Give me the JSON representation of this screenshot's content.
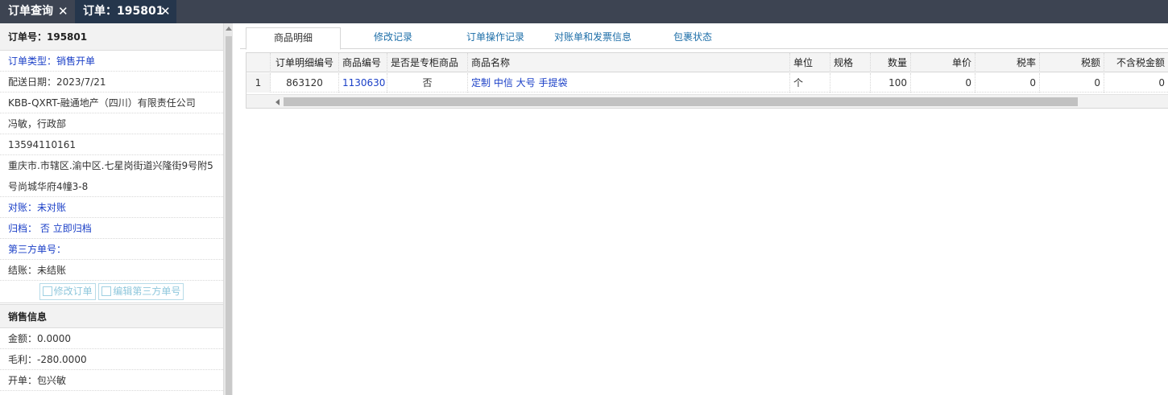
{
  "top_tabs": [
    {
      "label": "订单查询",
      "close": "✕"
    },
    {
      "label": "订单：195801",
      "close": "✕"
    }
  ],
  "order": {
    "header": "订单号：195801",
    "type": "订单类型：销售开单",
    "delivery_date": "配送日期：2023/7/21",
    "company": "KBB-QXRT-融通地产（四川）有限责任公司",
    "contact": "冯敏，行政部",
    "phone": "13594110161",
    "address": "重庆市.市辖区.渝中区.七星岗街道兴隆街9号附5号尚城华府4幢3-8",
    "reconcile": "对账：未对账",
    "archive_label": "归档：",
    "archive_value": "否",
    "archive_link": "立即归档",
    "third_party": "第三方单号：",
    "settle": "结账：未结账",
    "btn_edit": "修改订单",
    "btn_third": "编辑第三方单号"
  },
  "sales": {
    "header": "销售信息",
    "amount": "金额：0.0000",
    "profit": "毛利：-280.0000",
    "creator": "开单：包兴敏"
  },
  "detail_tabs": [
    "商品明细",
    "修改记录",
    "订单操作记录",
    "对账单和发票信息",
    "包裹状态"
  ],
  "grid": {
    "columns": [
      "",
      "订单明细编号",
      "商品编号",
      "是否是专柜商品",
      "商品名称",
      "单位",
      "规格",
      "数量",
      "单价",
      "税率",
      "税额",
      "不含税金额"
    ],
    "rows": [
      [
        "1",
        "863120",
        "1130630",
        "否",
        "定制 中信 大号 手提袋",
        "个",
        "",
        "100",
        "0",
        "0",
        "0",
        "0"
      ]
    ]
  }
}
